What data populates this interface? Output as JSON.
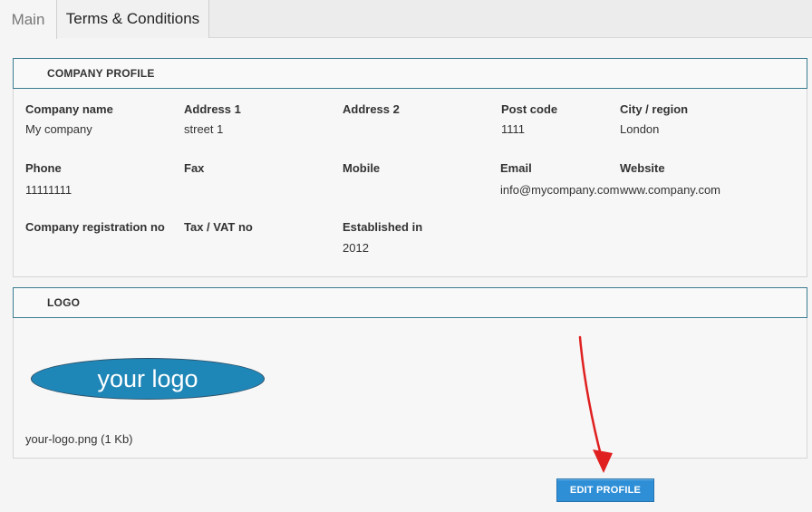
{
  "tabs": [
    {
      "label": "Main",
      "active": true
    },
    {
      "label": "Terms & Conditions",
      "active": false
    }
  ],
  "company_profile": {
    "header": "COMPANY PROFILE",
    "fields": {
      "company_name": {
        "label": "Company name",
        "value": "My company"
      },
      "address1": {
        "label": "Address 1",
        "value": "street 1"
      },
      "address2": {
        "label": "Address 2",
        "value": ""
      },
      "post_code": {
        "label": "Post code",
        "value": "1111"
      },
      "city": {
        "label": "City / region",
        "value": "London"
      },
      "phone": {
        "label": "Phone",
        "value": "11111111"
      },
      "fax": {
        "label": "Fax",
        "value": ""
      },
      "mobile": {
        "label": "Mobile",
        "value": ""
      },
      "email": {
        "label": "Email",
        "value": "info@mycompany.com"
      },
      "website": {
        "label": "Website",
        "value": "www.company.com"
      },
      "reg_no": {
        "label": "Company registration no",
        "value": ""
      },
      "vat_no": {
        "label": "Tax / VAT no",
        "value": ""
      },
      "established": {
        "label": "Established in",
        "value": "2012"
      }
    }
  },
  "logo_section": {
    "header": "LOGO",
    "logo_text": "your logo",
    "file_info": "your-logo.png (1 Kb)"
  },
  "actions": {
    "edit_profile_label": "EDIT PROFILE"
  },
  "colors": {
    "header_border": "#3a7c90",
    "button_bg": "#2f8fd6",
    "logo_bg": "#1f87b8",
    "arrow": "#e02020"
  }
}
